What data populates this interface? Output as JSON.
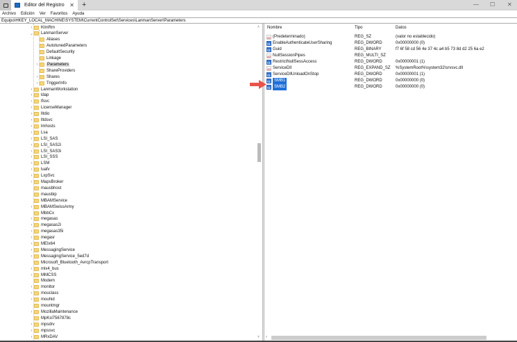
{
  "window": {
    "title": "Editor del Registro",
    "close": "✕",
    "new_tab": "+",
    "minimize": "—",
    "maximize": "☐",
    "win_close": "✕"
  },
  "menu": [
    "Archivo",
    "Edición",
    "Ver",
    "Favoritos",
    "Ayuda"
  ],
  "address": "Equipo\\HKEY_LOCAL_MACHINE\\SYSTEM\\CurrentControlSet\\Services\\LanmanServer\\Parameters",
  "tree": [
    {
      "label": "KtmRm",
      "level": 0,
      "exp": ">"
    },
    {
      "label": "LanmanServer",
      "level": 0,
      "exp": "v"
    },
    {
      "label": "Aliases",
      "level": 1,
      "exp": ""
    },
    {
      "label": "AutotunedParameters",
      "level": 1,
      "exp": ""
    },
    {
      "label": "DefaultSecurity",
      "level": 1,
      "exp": ""
    },
    {
      "label": "Linkage",
      "level": 1,
      "exp": ""
    },
    {
      "label": "Parameters",
      "level": 1,
      "exp": ">",
      "selected": true
    },
    {
      "label": "ShareProviders",
      "level": 1,
      "exp": ""
    },
    {
      "label": "Shares",
      "level": 1,
      "exp": ">"
    },
    {
      "label": "TriggerInfo",
      "level": 1,
      "exp": ">"
    },
    {
      "label": "LanmanWorkstation",
      "level": 0,
      "exp": ">"
    },
    {
      "label": "ldap",
      "level": 0,
      "exp": ">"
    },
    {
      "label": "lfsvc",
      "level": 0,
      "exp": ">"
    },
    {
      "label": "LicenseManager",
      "level": 0,
      "exp": ">"
    },
    {
      "label": "lltdio",
      "level": 0,
      "exp": ">"
    },
    {
      "label": "lltdsvc",
      "level": 0,
      "exp": ">"
    },
    {
      "label": "lmhosts",
      "level": 0,
      "exp": ">"
    },
    {
      "label": "Lsa",
      "level": 0,
      "exp": ">"
    },
    {
      "label": "LSI_SAS",
      "level": 0,
      "exp": ">"
    },
    {
      "label": "LSI_SAS2i",
      "level": 0,
      "exp": ">"
    },
    {
      "label": "LSI_SAS3i",
      "level": 0,
      "exp": ">"
    },
    {
      "label": "LSI_SSS",
      "level": 0,
      "exp": ">"
    },
    {
      "label": "LSM",
      "level": 0,
      "exp": ">"
    },
    {
      "label": "luafv",
      "level": 0,
      "exp": ">"
    },
    {
      "label": "LxpSvc",
      "level": 0,
      "exp": ">"
    },
    {
      "label": "MapsBroker",
      "level": 0,
      "exp": ">"
    },
    {
      "label": "mausbhost",
      "level": 0,
      "exp": ""
    },
    {
      "label": "mausbip",
      "level": 0,
      "exp": ""
    },
    {
      "label": "MBAMService",
      "level": 0,
      "exp": ""
    },
    {
      "label": "MBAMSwissArmy",
      "level": 0,
      "exp": ">"
    },
    {
      "label": "MbbCx",
      "level": 0,
      "exp": ""
    },
    {
      "label": "megasas",
      "level": 0,
      "exp": ">"
    },
    {
      "label": "megasas2i",
      "level": 0,
      "exp": ">"
    },
    {
      "label": "megasas35i",
      "level": 0,
      "exp": ">"
    },
    {
      "label": "megasr",
      "level": 0,
      "exp": ">"
    },
    {
      "label": "MEIx64",
      "level": 0,
      "exp": ">"
    },
    {
      "label": "MessagingService",
      "level": 0,
      "exp": ">"
    },
    {
      "label": "MessagingService_5ed7d",
      "level": 0,
      "exp": ">"
    },
    {
      "label": "Microsoft_Bluetooth_AvrcpTransport",
      "level": 0,
      "exp": ""
    },
    {
      "label": "mlx4_bus",
      "level": 0,
      "exp": ">"
    },
    {
      "label": "MMCSS",
      "level": 0,
      "exp": ">"
    },
    {
      "label": "Modem",
      "level": 0,
      "exp": ""
    },
    {
      "label": "monitor",
      "level": 0,
      "exp": ">"
    },
    {
      "label": "mouclass",
      "level": 0,
      "exp": ">"
    },
    {
      "label": "mouhid",
      "level": 0,
      "exp": ">"
    },
    {
      "label": "mountmgr",
      "level": 0,
      "exp": ""
    },
    {
      "label": "MozillaMaintenance",
      "level": 0,
      "exp": ">"
    },
    {
      "label": "MpKsl7567878c",
      "level": 0,
      "exp": ""
    },
    {
      "label": "mpsdrv",
      "level": 0,
      "exp": ">"
    },
    {
      "label": "mpssvc",
      "level": 0,
      "exp": ">"
    },
    {
      "label": "MRxDAV",
      "level": 0,
      "exp": ">"
    }
  ],
  "list": {
    "headers": {
      "name": "Nombre",
      "type": "Tipo",
      "data": "Datos"
    },
    "rows": [
      {
        "name": "(Predeterminado)",
        "type": "REG_SZ",
        "data": "(valor no establecido)",
        "icon": "sz"
      },
      {
        "name": "EnableAuthenticateUserSharing",
        "type": "REG_DWORD",
        "data": "0x00000000 (0)",
        "icon": "bin"
      },
      {
        "name": "Guid",
        "type": "REG_BINARY",
        "data": "f7 6f 58 cd 56 4e 37 4c a4 b5 73 8d d2 25 6a e2",
        "icon": "bin"
      },
      {
        "name": "NullSessionPipes",
        "type": "REG_MULTI_SZ",
        "data": "",
        "icon": "sz"
      },
      {
        "name": "RestrictNullSessAccess",
        "type": "REG_DWORD",
        "data": "0x00000001 (1)",
        "icon": "bin"
      },
      {
        "name": "ServiceDll",
        "type": "REG_EXPAND_SZ",
        "data": "%SystemRoot%\\system32\\srvsvc.dll",
        "icon": "sz"
      },
      {
        "name": "ServiceDllUnloadOnStop",
        "type": "REG_DWORD",
        "data": "0x00000001 (1)",
        "icon": "bin"
      },
      {
        "name": "SMB1",
        "type": "REG_DWORD",
        "data": "0x00000000 (0)",
        "icon": "bin",
        "selected": true
      },
      {
        "name": "SMB2",
        "type": "REG_DWORD",
        "data": "0x00000000 (0)",
        "icon": "bin",
        "selected": true
      }
    ]
  },
  "colors": {
    "selection": "#1e6fd9",
    "arrow": "#e8534a",
    "folder": "#f5d67b"
  }
}
